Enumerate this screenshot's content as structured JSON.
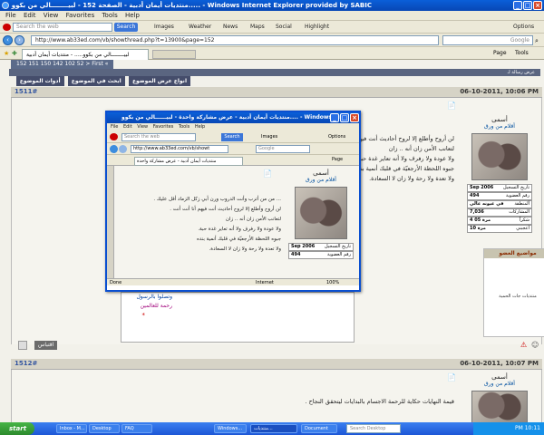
{
  "window": {
    "title": "منتديات أيمان أدبية - الصفحة 152 - لبيــــــــالي من بكوو..... - Windows Internet Explorer provided by SABIC",
    "menu": [
      "File",
      "Edit",
      "View",
      "Favorites",
      "Tools",
      "Help"
    ]
  },
  "toolbar": {
    "search_placeholder": "Search the web",
    "search_button": "Search",
    "items": [
      "Images",
      "Weather",
      "News",
      "Maps",
      "Social",
      "Highlight"
    ],
    "options": "Options"
  },
  "address": {
    "url": "http://www.ab33ed.com/vb/showthread.php?t=13900&page=152",
    "search_placeholder": "Google"
  },
  "tabs": {
    "active": "لبيــــــــالي من بكوو..... - منتديات أيمان أدبية",
    "page": "Page",
    "tools": "Tools"
  },
  "forum": {
    "pagination": "152 151 150 142 102 52 > First «",
    "bar_text": "عرض رسالة لـ",
    "nav_buttons": [
      "أدوات الموضوع",
      "ابحث في الموضوع",
      "انواع عرض الموضوع"
    ]
  },
  "post1": {
    "number": "1511#",
    "date": "06-10-2011, 10:06 PM",
    "username": "أسمى",
    "user_title": "أقلام من ورق",
    "stats": [
      {
        "label": "تاريخ التسجيل",
        "value": "Sep 2006"
      },
      {
        "label": "رقم العضوية",
        "value": "494"
      },
      {
        "label": "ألمنطقة",
        "value": "في عيونه عالي"
      },
      {
        "label": "المشاركات",
        "value": "7,036"
      },
      {
        "label": "شكراً",
        "value": "4 05 مرة"
      },
      {
        "label": "أعجبني",
        "value": "10 مرة"
      }
    ],
    "text": [
      "لن أروح وأطلع إلا لروح أحاديث أنت فيهم أنا",
      "لتعانب الأمن زان أنه .. زان",
      "ولا عودة ولا رفرف ولا أنه تعاير غدة حبة",
      "جبوه اللحظة الأرجعيّة في قلبك أنمية بنده",
      "ولا تعدة ولا رحة ولا زان لا السعادة."
    ],
    "related_heading": "مواضيع العضو",
    "related_item": "منتديات جات الحمية",
    "quote_button": "اقتباس"
  },
  "post2": {
    "number": "1512#",
    "date": "06-10-2011, 10:07 PM",
    "username": "أسمى",
    "user_title": "أقلام من ورق",
    "text": "قيمة النهايات حكاية للرحمة الاجسام بالبدايات ليتحقق النجاح ."
  },
  "popup": {
    "title": "منتديات أيمان أدبية - عرض مشاركة واحدة - لبيــــــالي من بكوو.... - Windows Int...",
    "menu": [
      "File",
      "Edit",
      "View",
      "Favorites",
      "Tools",
      "Help"
    ],
    "search_placeholder": "Search the web",
    "search_button": "Search",
    "images": "Images",
    "options": "Options",
    "url": "http://www.ab33ed.com/vb/showt",
    "google": "Google",
    "tab": "منتديات أيمان أدبية - عرض مشاركة واحدة",
    "page": "Page",
    "username": "أسمى",
    "user_title": "أقلام من ورق",
    "stats": [
      {
        "label": "تاريخ التسجيل",
        "value": "Sep 2006"
      },
      {
        "label": "رقم العضوية",
        "value": "494"
      }
    ],
    "text": [
      "... من من أترب وأنت الدروب ورن أبي زكل الزماد أقل عليك .",
      "لن أروح وأطلع إلا لروح أحاديث أنت فيهم أنا أنت أنت .",
      "لتعانب الأمن زان أنه .. زان",
      "ولا عودة ولا رفرف ولا أنه تعاير غدة حبة.",
      "جبوه اللحظة الأرجعيّة في قلبك أنمية بنده",
      "ولا تعدة ولا رحة ولا زان لا السعادة."
    ],
    "status_left": "Done",
    "status_zone": "Internet",
    "zoom": "100%"
  },
  "underpopup": {
    "line1": "وتصلوا بالرسول",
    "line2": "رحمة للعالمين",
    "star": "*"
  },
  "taskbar": {
    "start": "start",
    "tasks": [
      "Inbox - M...",
      "Desktop",
      "FAQ",
      "Windows...",
      "منتديات...",
      "Document"
    ],
    "desk_search": "Search Desktop",
    "clock": "PM 10:11"
  }
}
